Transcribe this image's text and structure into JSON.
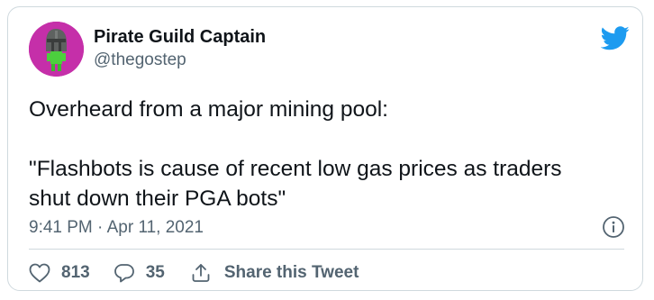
{
  "author": {
    "display_name": "Pirate Guild Captain",
    "handle": "@thegostep"
  },
  "tweet": {
    "lines": [
      "Overheard from a major mining pool:",
      "",
      "\"Flashbots is cause of recent low gas prices as traders",
      "shut down their PGA bots\""
    ],
    "timestamp": "9:41 PM · Apr 11, 2021"
  },
  "actions": {
    "like_count": "813",
    "reply_count": "35",
    "share_label": "Share this Tweet"
  },
  "icons": {
    "brand": "twitter-bird-icon",
    "info": "info-icon",
    "like": "heart-icon",
    "reply": "reply-bubble-icon",
    "share": "share-icon"
  },
  "colors": {
    "brand_blue": "#1d9bf0",
    "avatar_bg": "#c52fa9",
    "secondary_text": "#536471",
    "border": "#cfd9de"
  }
}
